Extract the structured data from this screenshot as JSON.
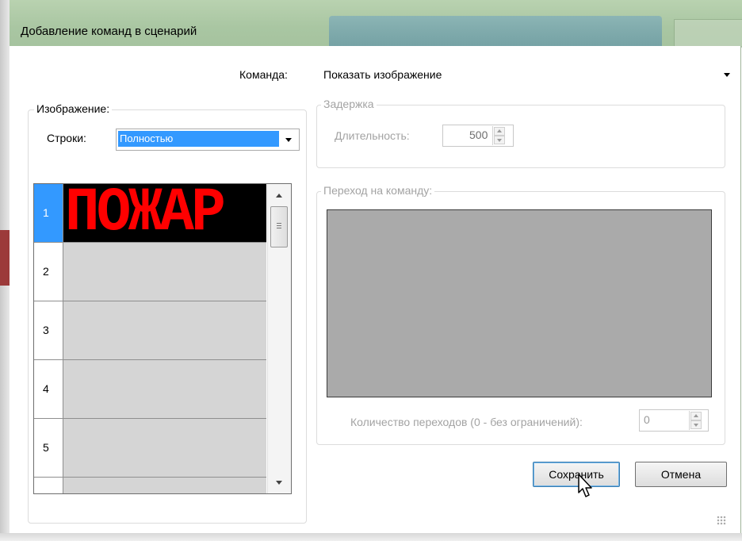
{
  "window": {
    "title": "Добавление команд в сценарий"
  },
  "command": {
    "label": "Команда:",
    "value": "Показать изображение"
  },
  "image_group": {
    "title": "Изображение:",
    "rows_label": "Строки:",
    "rows_value": "Полностью",
    "grid_rows": [
      {
        "num": "1",
        "content": "ПОЖАР",
        "selected": true
      },
      {
        "num": "2",
        "content": ""
      },
      {
        "num": "3",
        "content": ""
      },
      {
        "num": "4",
        "content": ""
      },
      {
        "num": "5",
        "content": ""
      }
    ]
  },
  "delay_group": {
    "title": "Задержка",
    "duration_label": "Длительность:",
    "duration_value": "500"
  },
  "goto_group": {
    "title": "Переход на команду:",
    "count_label": "Количество переходов (0 - без ограничений):",
    "count_value": "0"
  },
  "buttons": {
    "save": "Сохранить",
    "cancel": "Отмена"
  },
  "colors": {
    "selection": "#3399ff",
    "led_text": "#ff0000",
    "led_background": "#000000",
    "goto_area": "#aaaaaa"
  }
}
